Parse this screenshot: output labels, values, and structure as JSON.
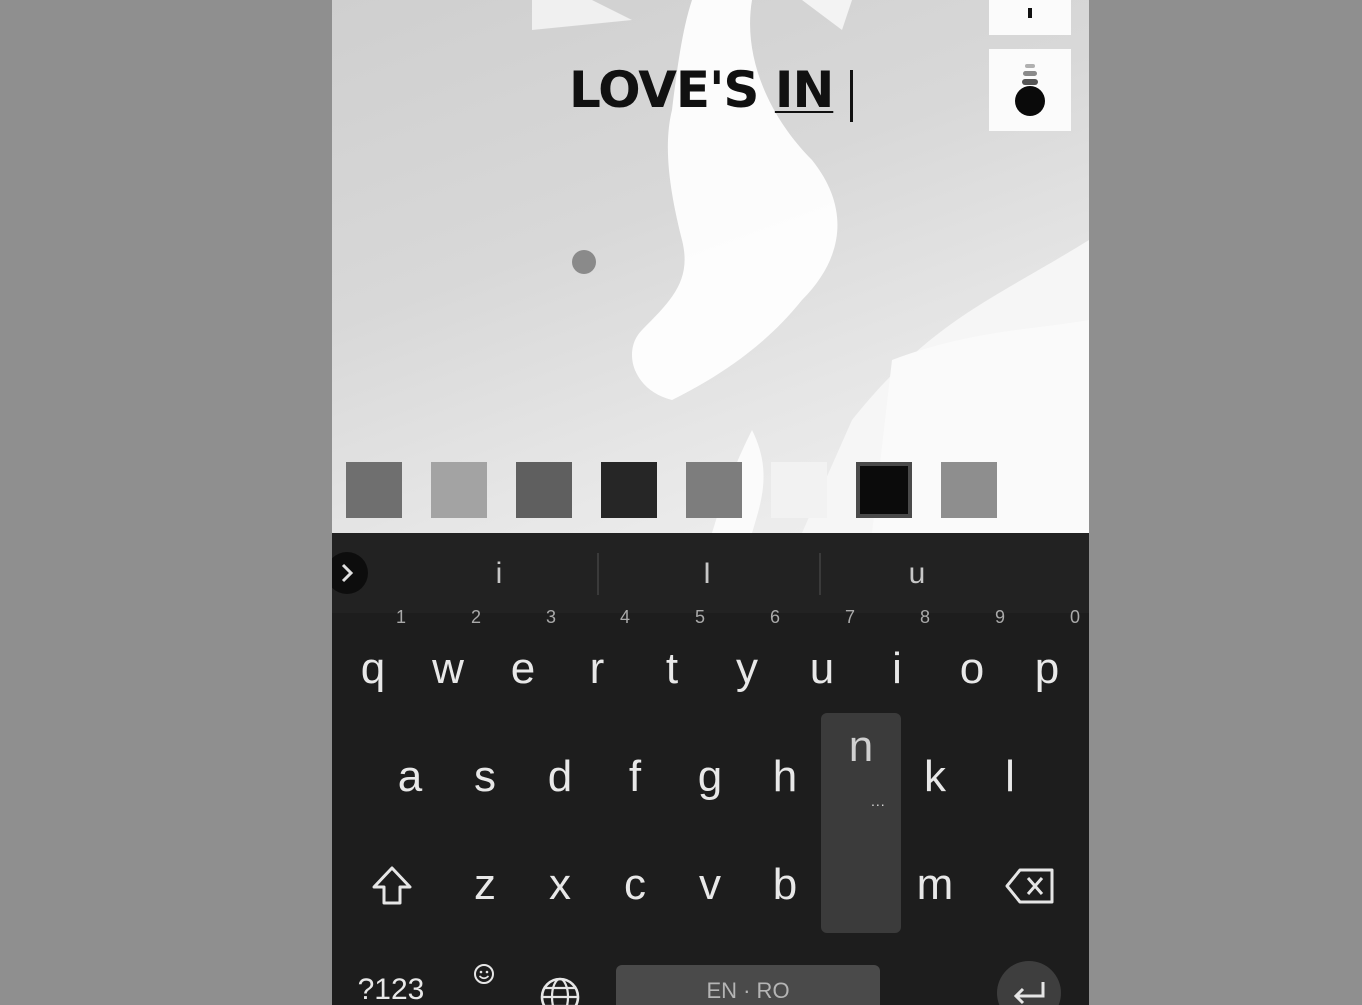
{
  "editor": {
    "caption_text": "LOVE'S",
    "caption_underlined": "IN",
    "style_button_icon": "text-background-style-icon",
    "top_button_icon": "add-text-icon"
  },
  "swatches": [
    {
      "color": "#6f6f6f",
      "selected": false
    },
    {
      "color": "#a3a3a3",
      "selected": false
    },
    {
      "color": "#5f5f5f",
      "selected": false
    },
    {
      "color": "#262626",
      "selected": false
    },
    {
      "color": "#7d7d7d",
      "selected": false
    },
    {
      "color": "#f2f2f2",
      "selected": false
    },
    {
      "color": "#0b0b0b",
      "selected": true
    },
    {
      "color": "#8e8e8e",
      "selected": false
    }
  ],
  "keyboard": {
    "suggestions": [
      "i",
      "I",
      "u"
    ],
    "row1": [
      "q",
      "w",
      "e",
      "r",
      "t",
      "y",
      "u",
      "i",
      "o",
      "p"
    ],
    "row1_hints": [
      "1",
      "2",
      "3",
      "4",
      "5",
      "6",
      "7",
      "8",
      "9",
      "0"
    ],
    "row2": [
      "a",
      "s",
      "d",
      "f",
      "g",
      "h",
      "n",
      "k",
      "l"
    ],
    "row3": [
      "z",
      "x",
      "c",
      "v",
      "b",
      "m"
    ],
    "pressed_key_dots": "...",
    "symbols_label": "?123",
    "space_label": "EN · RO",
    "icons": {
      "expand": "chevron-right-icon",
      "shift": "shift-icon",
      "backspace": "backspace-icon",
      "emoji": "emoji-icon",
      "globe": "globe-icon",
      "enter": "enter-icon"
    }
  }
}
